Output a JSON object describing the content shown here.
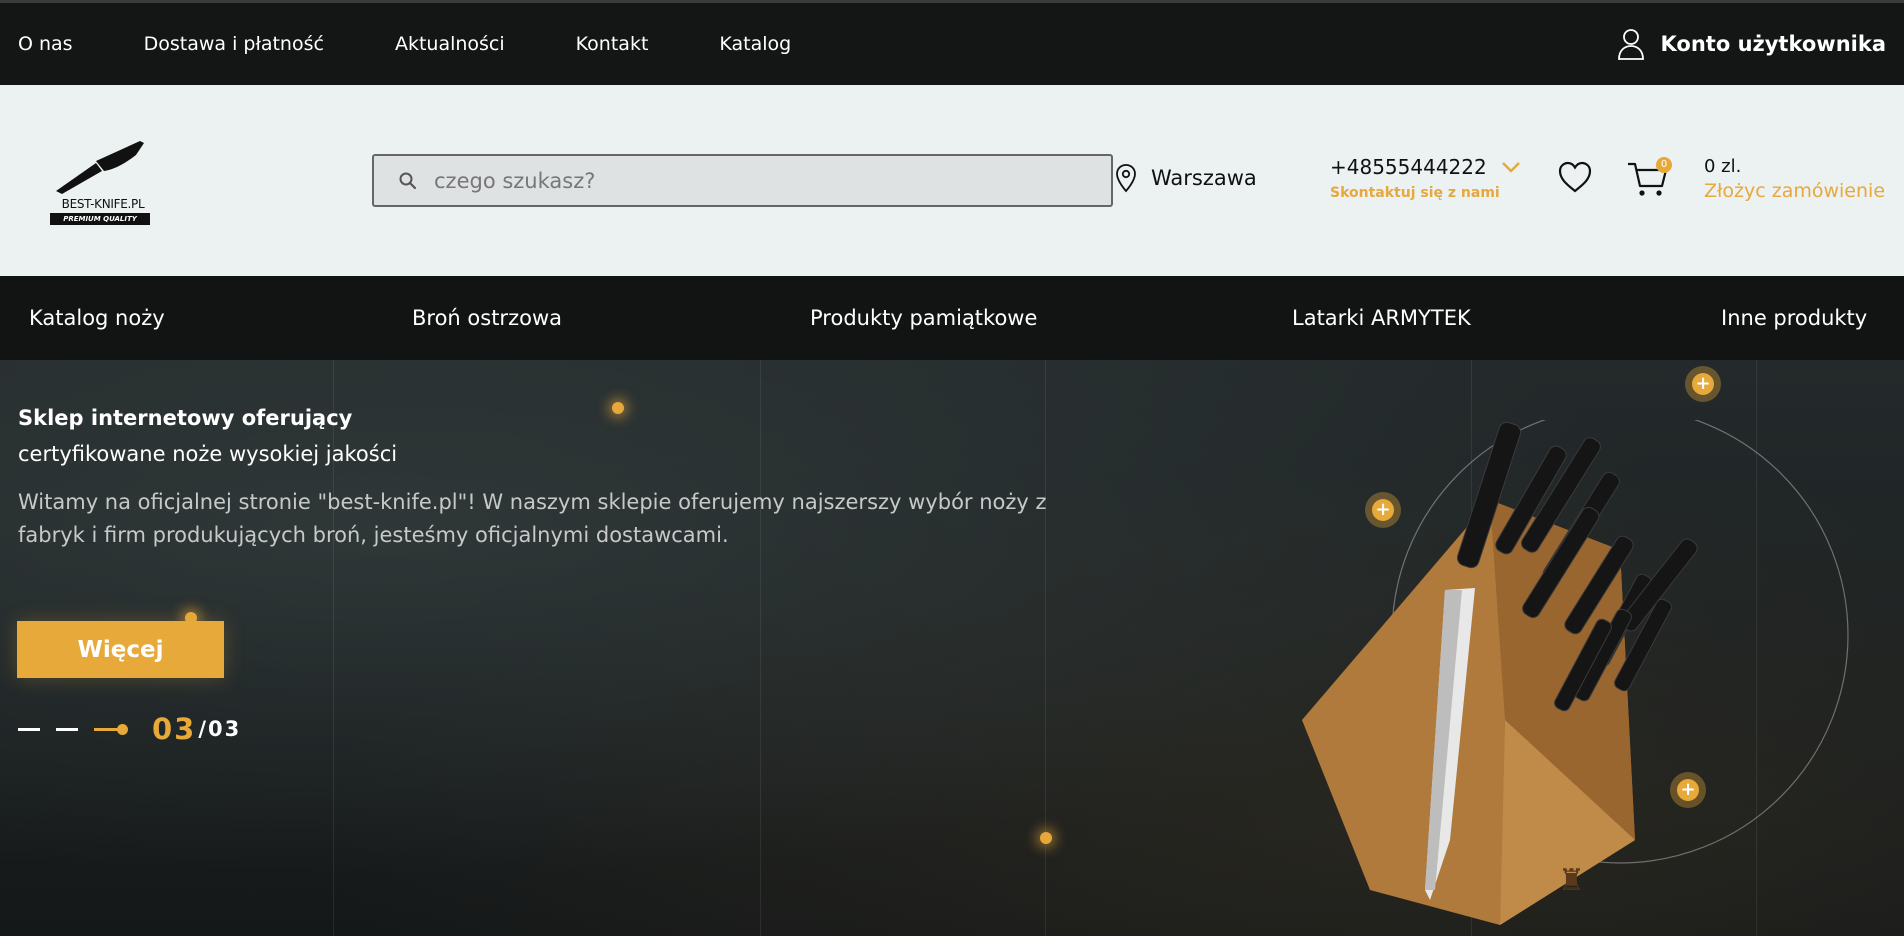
{
  "topnav": {
    "items": [
      "O nas",
      "Dostawa i płatność",
      "Aktualności",
      "Kontakt",
      "Katalog"
    ],
    "account_label": "Konto użytkownika"
  },
  "header": {
    "logo_text": "BEST-KNIFE.PL",
    "logo_tagline": "PREMIUM QUALITY",
    "search_placeholder": "czego szukasz?",
    "city": "Warszawa",
    "phone": "+48555444222",
    "contact_label": "Skontaktuj się z nami",
    "cart_count": "0",
    "cart_sum": "0 zl.",
    "order_label": "Złożyc zamówienie"
  },
  "categories": [
    "Katalog noży",
    "Broń ostrzowa",
    "Produkty pamiątkowe",
    "Latarki ARMYTEK",
    "Inne produkty"
  ],
  "hero": {
    "title": "Sklep internetowy oferujący",
    "subtitle": "certyfikowane noże wysokiej jakości",
    "description": "Witamy na oficjalnej stronie \"best-knife.pl\"! W naszym sklepie oferujemy najszerszy wybór noży z fabryk i firm produkujących broń, jesteśmy oficjalnymi dostawcami.",
    "button_label": "Więcej",
    "slide_current": "03",
    "slide_total": "/03"
  },
  "colors": {
    "accent": "#e6a93a",
    "dark": "#141515",
    "header_bg": "#ecf1f1"
  }
}
